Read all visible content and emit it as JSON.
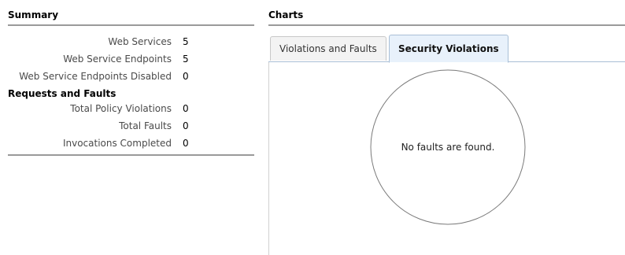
{
  "summary": {
    "title": "Summary",
    "services": [
      {
        "label": "Web Services",
        "value": "5"
      },
      {
        "label": "Web Service Endpoints",
        "value": "5"
      },
      {
        "label": "Web Service Endpoints Disabled",
        "value": "0"
      }
    ],
    "requests_heading": "Requests and Faults",
    "requests": [
      {
        "label": "Total Policy Violations",
        "value": "0"
      },
      {
        "label": "Total Faults",
        "value": "0"
      },
      {
        "label": "Invocations Completed",
        "value": "0"
      }
    ]
  },
  "charts": {
    "title": "Charts",
    "tabs": [
      {
        "label": "Violations and Faults",
        "active": false
      },
      {
        "label": "Security Violations",
        "active": true
      }
    ],
    "empty_message": "No faults are found."
  }
}
